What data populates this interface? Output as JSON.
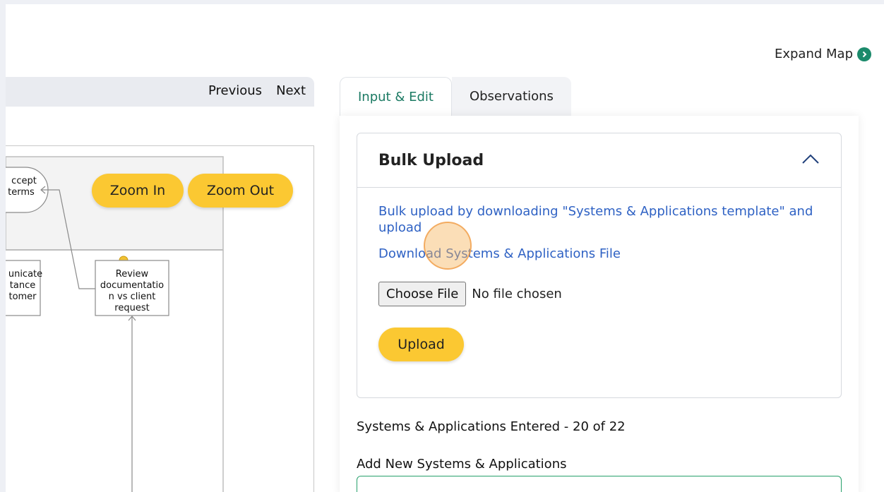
{
  "header": {
    "expand_map_label": "Expand Map"
  },
  "map": {
    "nav": {
      "previous_label": "Previous",
      "next_label": "Next"
    },
    "zoom_in_label": "Zoom In",
    "zoom_out_label": "Zoom Out",
    "nodes": {
      "accept_terms": [
        "ccept",
        "terms"
      ],
      "communicate": [
        "unicate",
        "tance",
        "tomer"
      ],
      "review": [
        "Review",
        "documentatio",
        "n vs client",
        "request"
      ]
    }
  },
  "tabs": [
    {
      "label": "Input & Edit",
      "active": true
    },
    {
      "label": "Observations",
      "active": false
    }
  ],
  "bulk_upload": {
    "title": "Bulk Upload",
    "description_link": "Bulk upload by downloading \"Systems & Applications template\" and upload",
    "download_link": "Download Systems & Applications File",
    "choose_file_label": "Choose File",
    "file_status": "No file chosen",
    "upload_label": "Upload"
  },
  "systems": {
    "entered_text": "Systems & Applications Entered - 20 of 22",
    "add_new_title": "Add New Systems & Applications"
  },
  "colors": {
    "accent": "#fbc832",
    "tab_active": "#1b7a63",
    "link": "#2f62c4",
    "input_border": "#27a06b"
  }
}
